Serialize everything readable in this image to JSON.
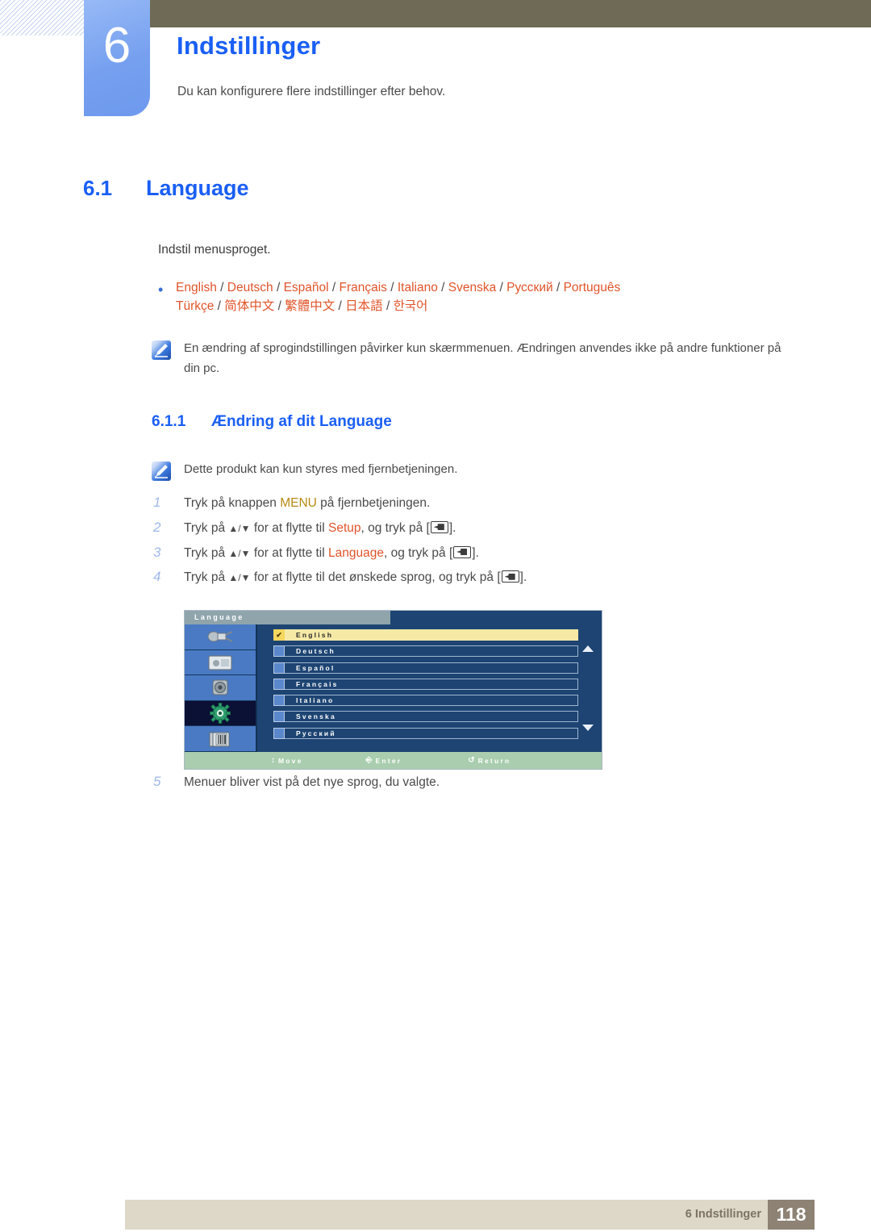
{
  "header": {
    "chapter_number": "6",
    "chapter_title": "Indstillinger",
    "chapter_subtitle": "Du kan konfigurere flere indstillinger efter behov."
  },
  "section": {
    "number": "6.1",
    "title": "Language",
    "intro": "Indstil menusproget.",
    "language_bullet": {
      "line1_langs": [
        "English",
        "Deutsch",
        "Español",
        "Français",
        "Italiano",
        "Svenska",
        "Русский",
        "Português"
      ],
      "line2_langs": [
        "Türkçe",
        "简体中文",
        "繁體中文",
        "日本語",
        "한국어"
      ],
      "separator": "/"
    },
    "note": "En ændring af sprogindstillingen påvirker kun skærmmenuen. Ændringen anvendes ikke på andre funktioner på din pc."
  },
  "subsection": {
    "number": "6.1.1",
    "title": "Ændring af dit Language",
    "note": "Dette produkt kan kun styres med fjernbetjeningen.",
    "steps": [
      {
        "num": "1",
        "parts": [
          {
            "t": "Tryk på knappen ",
            "style": "plain"
          },
          {
            "t": "MENU",
            "style": "menu"
          },
          {
            "t": " på fjernbetjeningen.",
            "style": "plain"
          }
        ]
      },
      {
        "num": "2",
        "parts": [
          {
            "t": "Tryk på ",
            "style": "plain"
          },
          {
            "t": "▲/▼",
            "style": "arrows"
          },
          {
            "t": " for at flytte til ",
            "style": "plain"
          },
          {
            "t": "Setup",
            "style": "orange"
          },
          {
            "t": ", og tryk på [",
            "style": "plain"
          },
          {
            "t": "",
            "style": "enterkey"
          },
          {
            "t": "].",
            "style": "plain"
          }
        ]
      },
      {
        "num": "3",
        "parts": [
          {
            "t": "Tryk på ",
            "style": "plain"
          },
          {
            "t": "▲/▼",
            "style": "arrows"
          },
          {
            "t": " for at flytte til ",
            "style": "plain"
          },
          {
            "t": "Language",
            "style": "orange"
          },
          {
            "t": ", og tryk på [",
            "style": "plain"
          },
          {
            "t": "",
            "style": "enterkey"
          },
          {
            "t": "].",
            "style": "plain"
          }
        ]
      },
      {
        "num": "4",
        "parts": [
          {
            "t": "Tryk på ",
            "style": "plain"
          },
          {
            "t": "▲/▼",
            "style": "arrows"
          },
          {
            "t": " for at flytte til det ønskede sprog, og tryk på [",
            "style": "plain"
          },
          {
            "t": "",
            "style": "enterkey"
          },
          {
            "t": "].",
            "style": "plain"
          }
        ]
      }
    ],
    "final_step": {
      "num": "5",
      "text": "Menuer bliver vist på det nye sprog, du valgte."
    }
  },
  "osd": {
    "title": "Language",
    "sidebar_icons": [
      "input-plug-icon",
      "picture-icon",
      "speaker-icon",
      "setup-gear-icon",
      "multi-screen-icon"
    ],
    "selected_sidebar_index": 3,
    "items": [
      {
        "label": "English",
        "checked": true,
        "highlighted": true
      },
      {
        "label": "Deutsch",
        "checked": false,
        "highlighted": false
      },
      {
        "label": "Español",
        "checked": false,
        "highlighted": false
      },
      {
        "label": "Français",
        "checked": false,
        "highlighted": false
      },
      {
        "label": "Italiano",
        "checked": false,
        "highlighted": false
      },
      {
        "label": "Svenska",
        "checked": false,
        "highlighted": false
      },
      {
        "label": "Русский",
        "checked": false,
        "highlighted": false
      }
    ],
    "check_glyph": "✔",
    "footer": {
      "move": "Move",
      "enter": "Enter",
      "return": "Return"
    }
  },
  "page_footer": {
    "label": "6 Indstillinger",
    "page_number": "118"
  },
  "colors": {
    "heading_blue": "#1a5ff5",
    "chapter_block_blue": "#7ba3f0",
    "olive_bar": "#6e6a55",
    "orange": "#e0542a",
    "menu_gold": "#b58a12",
    "step_num_blue": "#9fb8e8",
    "footer_beige": "#ddd8c8",
    "page_num_taupe": "#8d8273",
    "osd_panel": "#1d4472",
    "osd_sidebar": "#4a7ac4",
    "osd_highlight": "#f6e9a6",
    "osd_footer_green": "#a9cdae"
  }
}
